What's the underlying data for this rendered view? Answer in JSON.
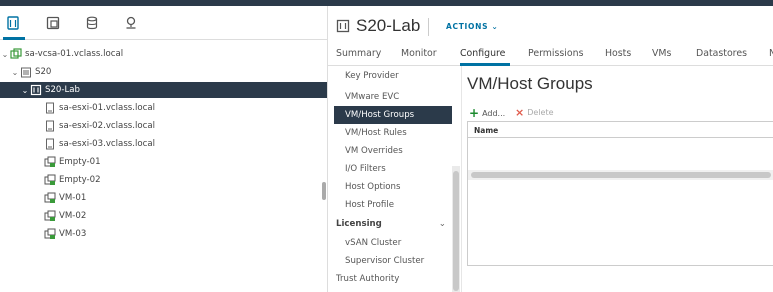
{
  "left_panel": {
    "tabs": [
      {
        "icon": "hosts-clusters-icon"
      },
      {
        "icon": "vms-templates-icon"
      },
      {
        "icon": "storage-icon"
      },
      {
        "icon": "networking-icon"
      }
    ],
    "tree": [
      {
        "label": "sa-vcsa-01.vclass.local",
        "icon": "vcenter-icon",
        "expanded": true
      },
      {
        "label": "S20",
        "icon": "datacenter-icon",
        "expanded": true
      },
      {
        "label": "S20-Lab",
        "icon": "cluster-icon",
        "expanded": true,
        "selected": true
      },
      {
        "label": "sa-esxi-01.vclass.local",
        "icon": "host-icon"
      },
      {
        "label": "sa-esxi-02.vclass.local",
        "icon": "host-icon"
      },
      {
        "label": "sa-esxi-03.vclass.local",
        "icon": "host-icon"
      },
      {
        "label": "Empty-01",
        "icon": "vm-icon"
      },
      {
        "label": "Empty-02",
        "icon": "vm-icon"
      },
      {
        "label": "VM-01",
        "icon": "vm-icon"
      },
      {
        "label": "VM-02",
        "icon": "vm-icon"
      },
      {
        "label": "VM-03",
        "icon": "vm-icon"
      }
    ]
  },
  "header": {
    "object_name": "S20-Lab",
    "actions_label": "ACTIONS"
  },
  "tabs": [
    {
      "label": "Summary"
    },
    {
      "label": "Monitor"
    },
    {
      "label": "Configure",
      "active": true
    },
    {
      "label": "Permissions"
    },
    {
      "label": "Hosts"
    },
    {
      "label": "VMs"
    },
    {
      "label": "Datastores"
    },
    {
      "label": "N"
    }
  ],
  "subnav": [
    {
      "label": "Key Provider"
    },
    {
      "label": "VMware EVC"
    },
    {
      "label": "VM/Host Groups",
      "active": true
    },
    {
      "label": "VM/Host Rules"
    },
    {
      "label": "VM Overrides"
    },
    {
      "label": "I/O Filters"
    },
    {
      "label": "Host Options"
    },
    {
      "label": "Host Profile"
    },
    {
      "label": "Licensing",
      "section": true
    },
    {
      "label": "vSAN Cluster"
    },
    {
      "label": "Supervisor Cluster"
    },
    {
      "label": "Trust Authority",
      "toplevel": true
    }
  ],
  "content": {
    "title": "VM/Host Groups",
    "add_label": "Add...",
    "delete_label": "Delete",
    "column_name": "Name"
  },
  "colors": {
    "accent": "#0072a3",
    "selected_bg": "#2b3a4a",
    "add_green": "#1b8a2e",
    "delete_red": "#e05a4a"
  }
}
